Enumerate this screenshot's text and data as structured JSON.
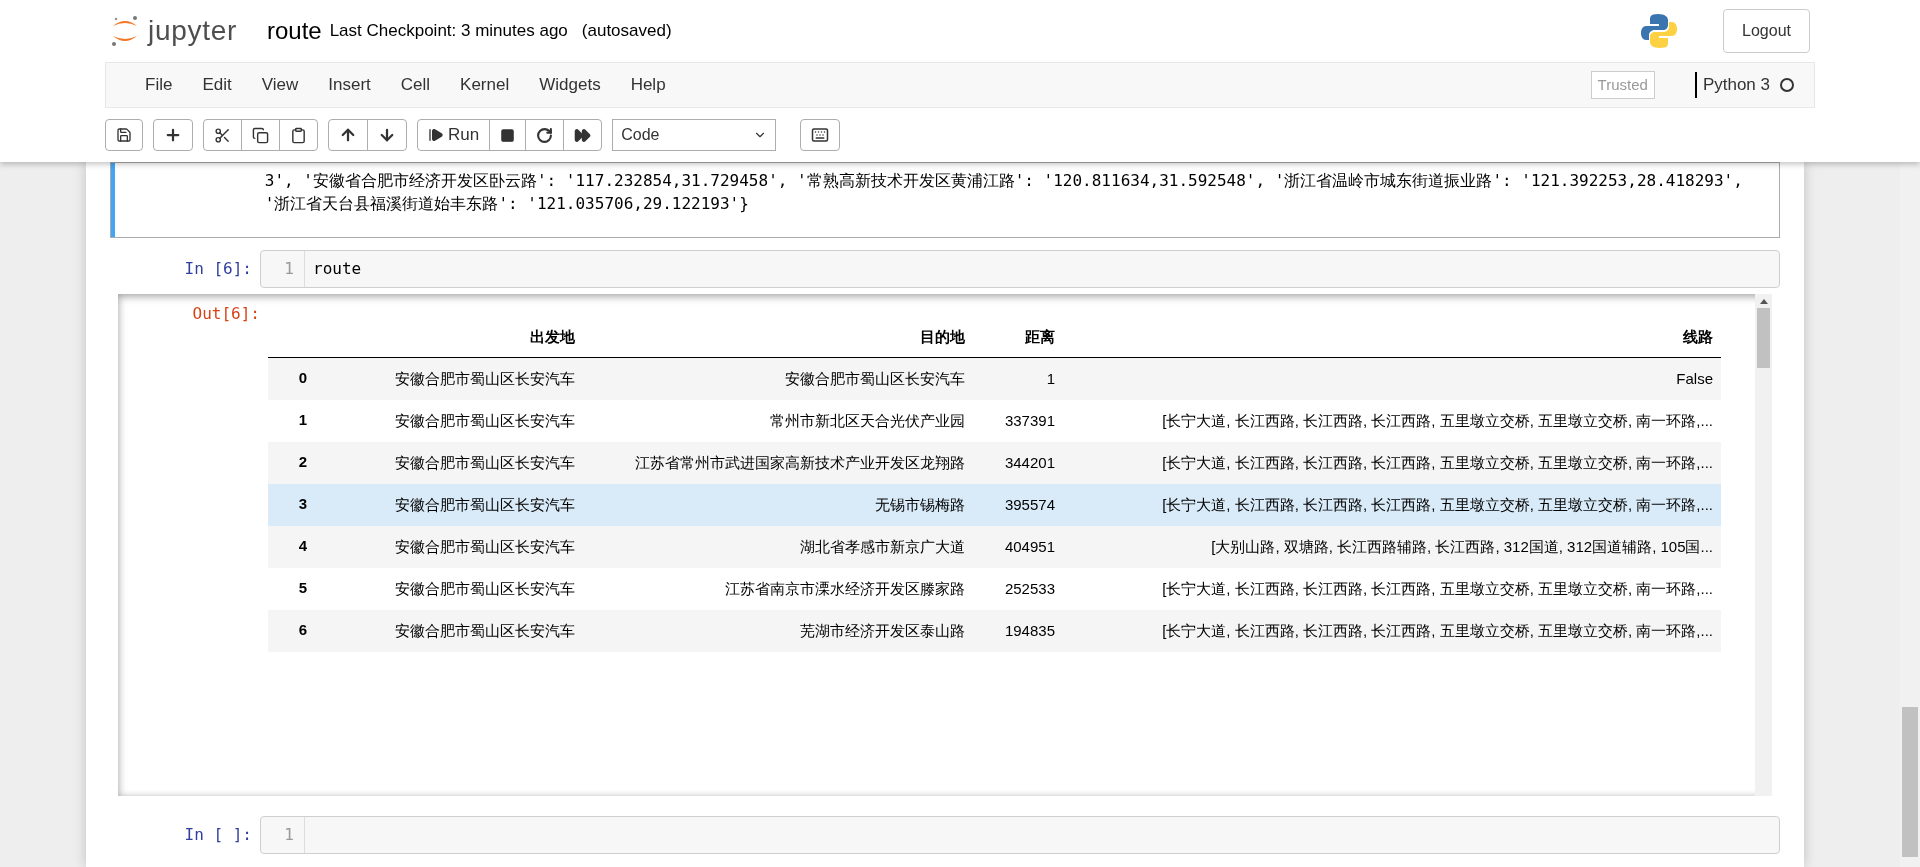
{
  "header": {
    "logo_text": "jupyter",
    "notebook_name": "route",
    "checkpoint": "Last Checkpoint: 3 minutes ago",
    "autosave": "(autosaved)",
    "logout": "Logout"
  },
  "menu": {
    "items": [
      "File",
      "Edit",
      "View",
      "Insert",
      "Cell",
      "Kernel",
      "Widgets",
      "Help"
    ],
    "trusted": "Trusted",
    "kernel": "Python 3",
    "kernel_busy": false
  },
  "toolbar": {
    "run_label": "Run",
    "cell_type": "Code"
  },
  "prev_output": {
    "text": "3', '安徽省合肥市经济开发区卧云路': '117.232854,31.729458', '常熟高新技术开发区黄浦江路': '120.811634,31.592548', '浙江省温岭市城东街道振业路': '121.392253,28.418293', '浙江省天台县福溪街道始丰东路': '121.035706,29.122193'}",
    "selected": true
  },
  "cell": {
    "prompt": "In [6]:",
    "line_number": "1",
    "code": "route",
    "out_prompt": "Out[6]:"
  },
  "table": {
    "columns": [
      "出发地",
      "目的地",
      "距离",
      "线路"
    ],
    "rows": [
      {
        "index": "0",
        "cells": [
          "安徽合肥市蜀山区长安汽车",
          "安徽合肥市蜀山区长安汽车",
          "1",
          "False"
        ],
        "selected": false
      },
      {
        "index": "1",
        "cells": [
          "安徽合肥市蜀山区长安汽车",
          "常州市新北区天合光伏产业园",
          "337391",
          "[长宁大道, 长江西路, 长江西路, 长江西路, 五里墩立交桥, 五里墩立交桥, 南一环路,..."
        ],
        "selected": false
      },
      {
        "index": "2",
        "cells": [
          "安徽合肥市蜀山区长安汽车",
          "江苏省常州市武进国家高新技术产业开发区龙翔路",
          "344201",
          "[长宁大道, 长江西路, 长江西路, 长江西路, 五里墩立交桥, 五里墩立交桥, 南一环路,..."
        ],
        "selected": false
      },
      {
        "index": "3",
        "cells": [
          "安徽合肥市蜀山区长安汽车",
          "无锡市锡梅路",
          "395574",
          "[长宁大道, 长江西路, 长江西路, 长江西路, 五里墩立交桥, 五里墩立交桥, 南一环路,..."
        ],
        "selected": true
      },
      {
        "index": "4",
        "cells": [
          "安徽合肥市蜀山区长安汽车",
          "湖北省孝感市新京广大道",
          "404951",
          "[大别山路, 双塘路, 长江西路辅路, 长江西路, 312国道, 312国道辅路, 105国..."
        ],
        "selected": false
      },
      {
        "index": "5",
        "cells": [
          "安徽合肥市蜀山区长安汽车",
          "江苏省南京市溧水经济开发区滕家路",
          "252533",
          "[长宁大道, 长江西路, 长江西路, 长江西路, 五里墩立交桥, 五里墩立交桥, 南一环路,..."
        ],
        "selected": false
      },
      {
        "index": "6",
        "cells": [
          "安徽合肥市蜀山区长安汽车",
          "芜湖市经济开发区泰山路",
          "194835",
          "[长宁大道, 长江西路, 长江西路, 长江西路, 五里墩立交桥, 五里墩立交桥, 南一环路,..."
        ],
        "selected": false
      }
    ]
  },
  "next_cell": {
    "prompt": "In [ ]:",
    "line_number": "1"
  }
}
